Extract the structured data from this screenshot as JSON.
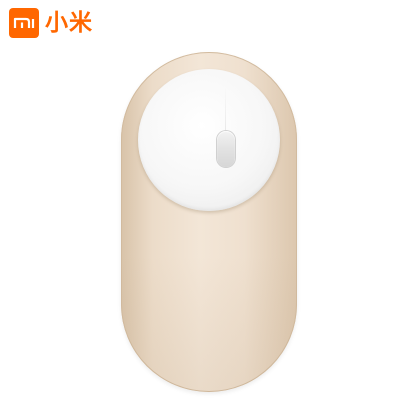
{
  "brand": {
    "logo_text": "mi",
    "name": "小米",
    "color": "#ff6700"
  },
  "product": {
    "icon": "wireless-mouse",
    "body_color": "#efe0cf",
    "top_color": "#f7f7f7"
  }
}
